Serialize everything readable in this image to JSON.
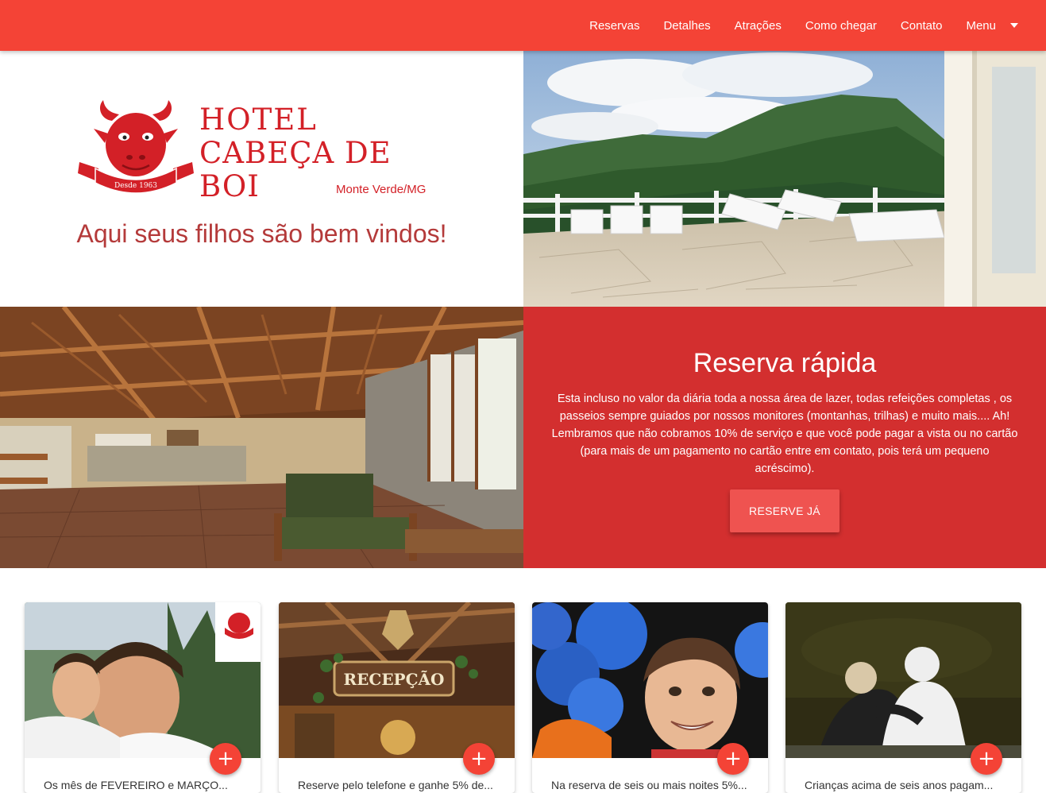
{
  "nav": {
    "items": [
      "Reservas",
      "Detalhes",
      "Atrações",
      "Como chegar",
      "Contato"
    ],
    "menu_label": "Menu"
  },
  "hero": {
    "logo": {
      "line1": "HOTEL",
      "line2": "CABEÇA DE BOI",
      "sub": "Monte Verde/MG",
      "ribbon": "Desde 1963"
    },
    "tagline": "Aqui seus filhos são bem vindos!"
  },
  "reserve": {
    "title": "Reserva rápida",
    "text": "Esta incluso no valor da diária toda a nossa área de lazer, todas refeições completas , os passeios sempre guiados por nossos monitores (montanhas, trilhas) e muito mais.... Ah! Lembramos que não cobramos 10% de serviço e que você pode pagar a vista ou no cartão (para mais de um pagamento no cartão entre em contato, pois terá um pequeno acréscimo).",
    "button": "RESERVE JÁ"
  },
  "cards": [
    {
      "image": "father-son-photo",
      "text": "Os mês de FEVEREIRO e MARÇO..."
    },
    {
      "image": "recepcao-sign-photo",
      "text": "Reserve pelo telefone e ganhe 5% de..."
    },
    {
      "image": "boy-balloons-photo",
      "text": "Na reserva de seis ou mais noites 5%..."
    },
    {
      "image": "couple-lake-photo",
      "text": "Crianças acima de seis anos pagam..."
    }
  ],
  "fab_label": "+",
  "colors": {
    "primary": "#f44336",
    "reserve_bg": "#d32f2f",
    "logo_red": "#d32027",
    "tagline": "#b43a3a"
  }
}
